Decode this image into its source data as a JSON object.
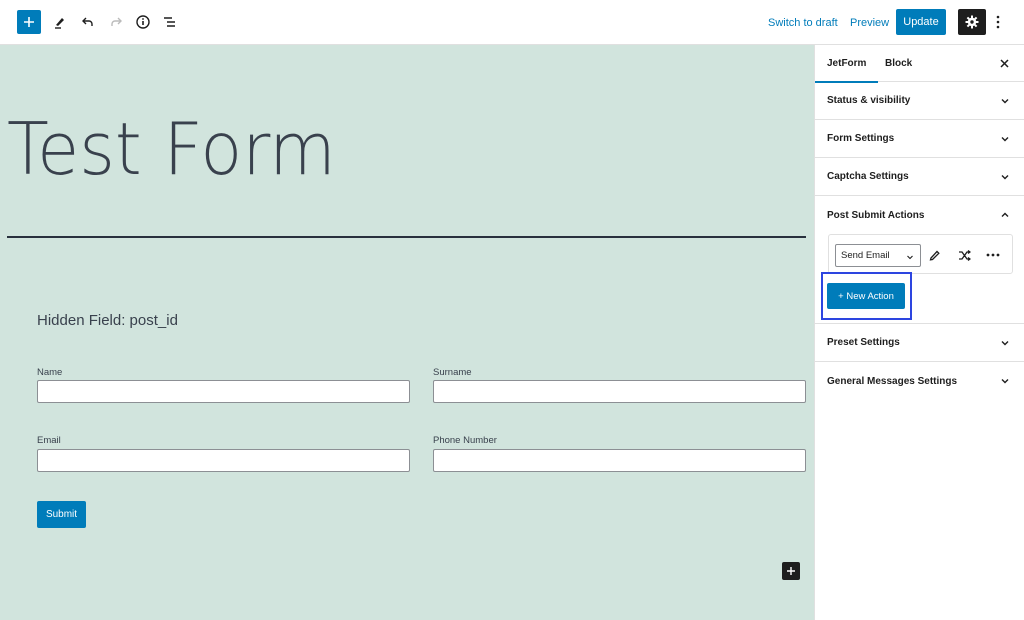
{
  "toolbar": {
    "add_block_icon": "plus-icon",
    "tools_icon": "pencil-icon",
    "undo_icon": "undo-icon",
    "redo_icon": "redo-icon",
    "info_icon": "info-icon",
    "list_view_icon": "list-view-icon",
    "switch_to_draft_label": "Switch to draft",
    "preview_label": "Preview",
    "update_label": "Update",
    "settings_icon": "gear-icon",
    "more_icon": "vertical-ellipsis-icon"
  },
  "canvas": {
    "title": "Test Form",
    "hidden_field": "Hidden Field: post_id",
    "fields": [
      {
        "label": "Name",
        "value": ""
      },
      {
        "label": "Surname",
        "value": ""
      },
      {
        "label": "Email",
        "value": ""
      },
      {
        "label": "Phone Number",
        "value": ""
      }
    ],
    "submit_label": "Submit",
    "inserter_icon": "plus-icon"
  },
  "sidebar": {
    "tabs": [
      {
        "label": "JetForm",
        "active": true
      },
      {
        "label": "Block",
        "active": false
      }
    ],
    "close_icon": "close-icon",
    "panels": [
      {
        "label": "Status & visibility",
        "expanded": false
      },
      {
        "label": "Form Settings",
        "expanded": false
      },
      {
        "label": "Captcha Settings",
        "expanded": false
      },
      {
        "label": "Post Submit Actions",
        "expanded": true
      },
      {
        "label": "Preset Settings",
        "expanded": false
      },
      {
        "label": "General Messages Settings",
        "expanded": false
      }
    ],
    "post_submit_actions": {
      "action_type": "Send Email",
      "edit_icon": "pencil-icon",
      "conditions_icon": "shuffle-icon",
      "more_icon": "horizontal-ellipsis-icon",
      "new_action_label": "+ New Action"
    }
  },
  "colors": {
    "accent": "#007cba",
    "canvas_bg": "#d1e4dd",
    "text_dark": "#39414d",
    "highlight": "#2d45e0"
  }
}
